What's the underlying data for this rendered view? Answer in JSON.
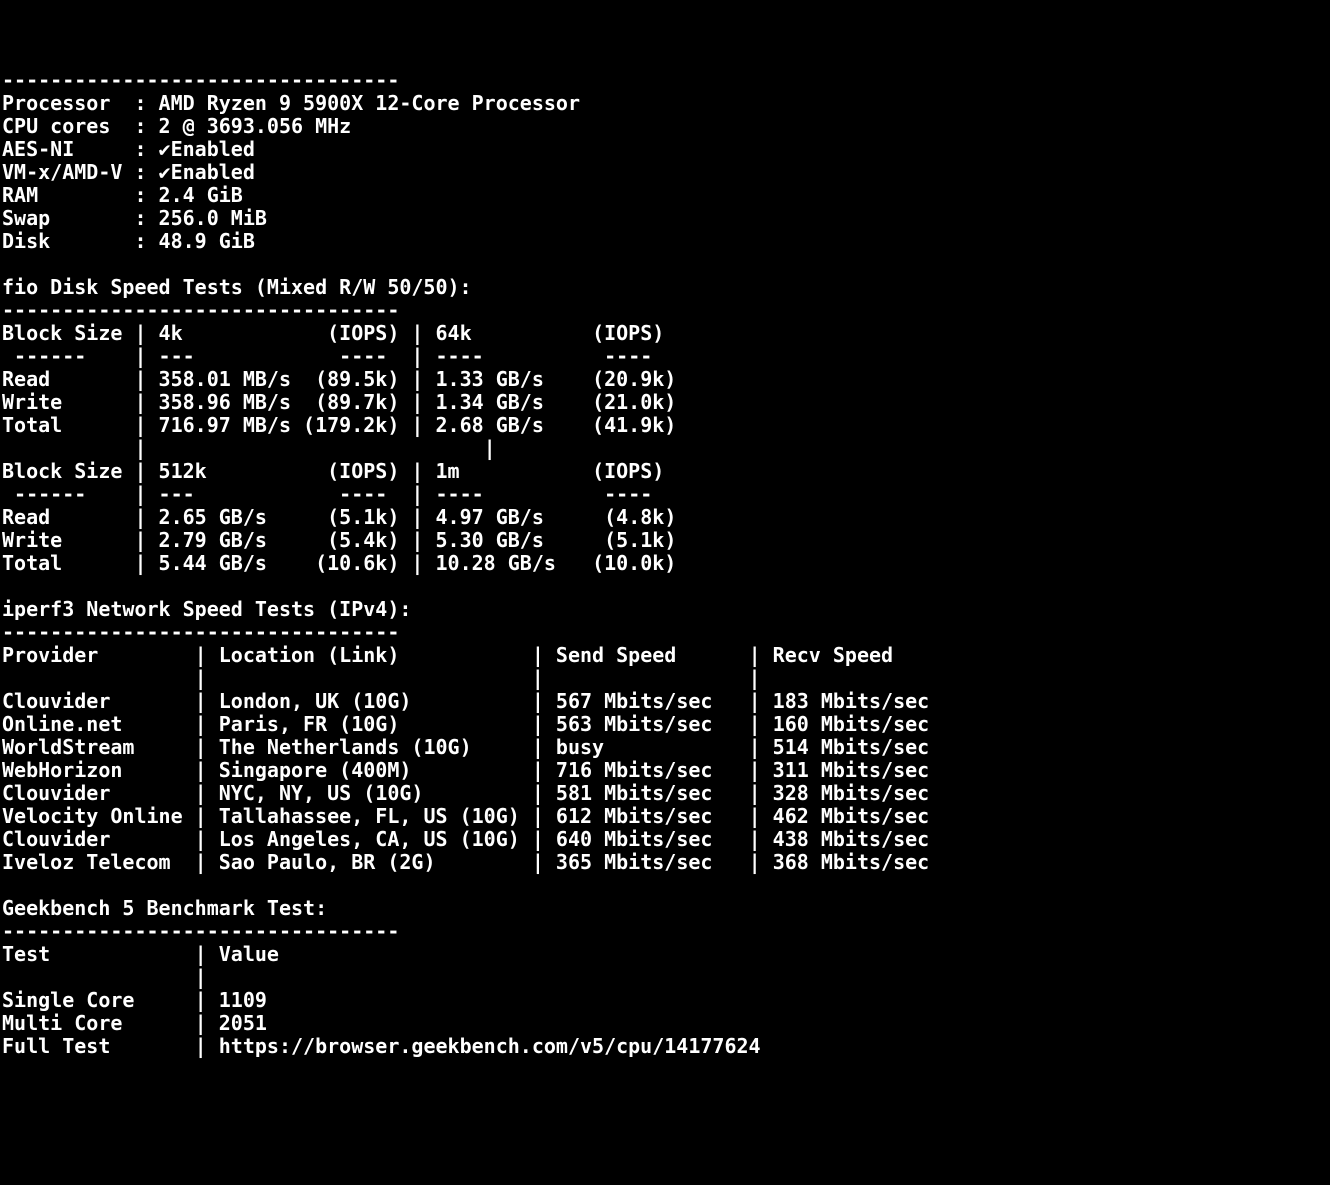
{
  "divider_top": "---------------------------------",
  "sysinfo": {
    "processor_label": "Processor  :",
    "processor_value": "AMD Ryzen 9 5900X 12-Core Processor",
    "cores_label": "CPU cores  :",
    "cores_value": "2 @ 3693.056 MHz",
    "aesni_label": "AES-NI     :",
    "aesni_value": "Enabled",
    "vmx_label": "VM-x/AMD-V :",
    "vmx_value": "Enabled",
    "ram_label": "RAM        :",
    "ram_value": "2.4 GiB",
    "swap_label": "Swap       :",
    "swap_value": "256.0 MiB",
    "disk_label": "Disk       :",
    "disk_value": "48.9 GiB"
  },
  "fio": {
    "title": "fio Disk Speed Tests (Mixed R/W 50/50):",
    "divider": "---------------------------------",
    "hdr_block": "Block Size",
    "iops_label": "(IOPS)",
    "read_label": "Read",
    "write_label": "Write",
    "total_label": "Total",
    "sub_dashes": " ------   ",
    "sub_dashes2": "---",
    "sub_dashes3": "---- ",
    "sub_dashes4": "----",
    "group1": {
      "col1": "4k",
      "col2": "64k",
      "read": {
        "c1": "358.01 MB/s",
        "c1i": "(89.5k)",
        "c2": "1.33 GB/s",
        "c2i": "(20.9k)"
      },
      "write": {
        "c1": "358.96 MB/s",
        "c1i": "(89.7k)",
        "c2": "1.34 GB/s",
        "c2i": "(21.0k)"
      },
      "total": {
        "c1": "716.97 MB/s",
        "c1i": "(179.2k)",
        "c2": "2.68 GB/s",
        "c2i": "(41.9k)"
      }
    },
    "group2": {
      "col1": "512k",
      "col2": "1m",
      "read": {
        "c1": "2.65 GB/s",
        "c1i": "(5.1k)",
        "c2": "4.97 GB/s",
        "c2i": "(4.8k)"
      },
      "write": {
        "c1": "2.79 GB/s",
        "c1i": "(5.4k)",
        "c2": "5.30 GB/s",
        "c2i": "(5.1k)"
      },
      "total": {
        "c1": "5.44 GB/s",
        "c1i": "(10.6k)",
        "c2": "10.28 GB/s",
        "c2i": "(10.0k)"
      }
    }
  },
  "iperf": {
    "title": "iperf3 Network Speed Tests (IPv4):",
    "divider": "---------------------------------",
    "hdr_provider": "Provider",
    "hdr_location": "Location (Link)",
    "hdr_send": "Send Speed",
    "hdr_recv": "Recv Speed",
    "rows": [
      {
        "provider": "Clouvider",
        "location": "London, UK (10G)",
        "send": "567 Mbits/sec",
        "recv": "183 Mbits/sec"
      },
      {
        "provider": "Online.net",
        "location": "Paris, FR (10G)",
        "send": "563 Mbits/sec",
        "recv": "160 Mbits/sec"
      },
      {
        "provider": "WorldStream",
        "location": "The Netherlands (10G)",
        "send": "busy",
        "recv": "514 Mbits/sec"
      },
      {
        "provider": "WebHorizon",
        "location": "Singapore (400M)",
        "send": "716 Mbits/sec",
        "recv": "311 Mbits/sec"
      },
      {
        "provider": "Clouvider",
        "location": "NYC, NY, US (10G)",
        "send": "581 Mbits/sec",
        "recv": "328 Mbits/sec"
      },
      {
        "provider": "Velocity Online",
        "location": "Tallahassee, FL, US (10G)",
        "send": "612 Mbits/sec",
        "recv": "462 Mbits/sec"
      },
      {
        "provider": "Clouvider",
        "location": "Los Angeles, CA, US (10G)",
        "send": "640 Mbits/sec",
        "recv": "438 Mbits/sec"
      },
      {
        "provider": "Iveloz Telecom",
        "location": "Sao Paulo, BR (2G)",
        "send": "365 Mbits/sec",
        "recv": "368 Mbits/sec"
      }
    ]
  },
  "geekbench": {
    "title": "Geekbench 5 Benchmark Test:",
    "divider": "---------------------------------",
    "hdr_test": "Test",
    "hdr_value": "Value",
    "single_label": "Single Core",
    "single_value": "1109",
    "multi_label": "Multi Core",
    "multi_value": "2051",
    "full_label": "Full Test",
    "full_value": "https://browser.geekbench.com/v5/cpu/14177624"
  }
}
